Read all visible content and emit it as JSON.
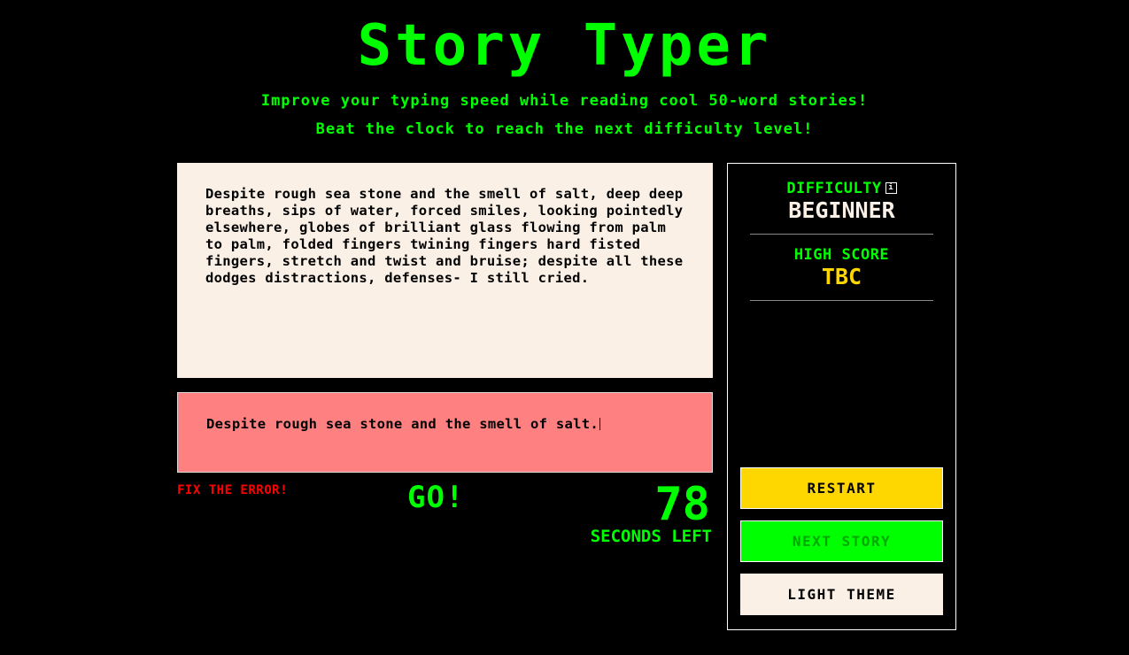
{
  "header": {
    "title": "Story Typer",
    "subtitle_line1": "Improve your typing speed while reading cool 50-word stories!",
    "subtitle_line2": "Beat the clock to reach the next difficulty level!"
  },
  "story": {
    "text": "Despite rough sea stone and the smell of salt, deep deep breaths, sips of water, forced smiles, looking pointedly elsewhere, globes of brilliant glass flowing from palm to palm, folded fingers twining fingers hard fisted fingers, stretch and twist and bruise; despite all these dodges distractions, defenses- I still cried."
  },
  "typing": {
    "value": "Despite rough sea stone and the smell of salt.",
    "status": "error"
  },
  "status": {
    "error_message": "FIX THE ERROR!",
    "go_label": "GO!",
    "seconds_value": "78",
    "seconds_label": "SECONDS LEFT"
  },
  "panel": {
    "difficulty_label": "DIFFICULTY",
    "info_icon": "info-icon",
    "difficulty_value": "BEGINNER",
    "high_score_label": "HIGH SCORE",
    "high_score_value": "TBC"
  },
  "buttons": {
    "restart": "RESTART",
    "next_story": "NEXT STORY",
    "next_story_enabled": false,
    "theme": "LIGHT THEME"
  },
  "colors": {
    "background": "#000000",
    "accent_green": "#00ff00",
    "error_red": "#ff0000",
    "typing_error_bg": "#ff8080",
    "story_bg": "#faf0e6",
    "gold": "#ffd700"
  }
}
